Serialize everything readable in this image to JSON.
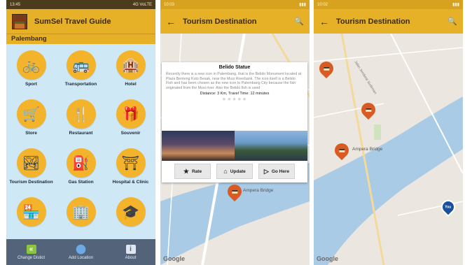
{
  "screen1": {
    "status": {
      "time": "13:45",
      "network": "4G VoLTE"
    },
    "app_title": "SumSel Travel Guide",
    "location": "Palembang",
    "categories": [
      {
        "label": "Sport",
        "icon": "bicycle-icon",
        "glyph": "🚲"
      },
      {
        "label": "Transportation",
        "icon": "bus-icon",
        "glyph": "🚌"
      },
      {
        "label": "Hotel",
        "icon": "hotel-icon",
        "glyph": "🏨"
      },
      {
        "label": "Store",
        "icon": "shopping-cart-icon",
        "glyph": "🛒"
      },
      {
        "label": "Restaurant",
        "icon": "cutlery-icon",
        "glyph": "🍴"
      },
      {
        "label": "Souvenir",
        "icon": "gift-icon",
        "glyph": "🎁"
      },
      {
        "label": "Tourism Destination",
        "icon": "landscape-icon",
        "glyph": "🏞"
      },
      {
        "label": "Gas Station",
        "icon": "fuel-pump-icon",
        "glyph": "⛽"
      },
      {
        "label": "Hospital & Clinic",
        "icon": "torii-gate-icon",
        "glyph": "⛩"
      },
      {
        "label": "",
        "icon": "shop-front-icon",
        "glyph": "🏪"
      },
      {
        "label": "",
        "icon": "office-building-icon",
        "glyph": "🏢"
      },
      {
        "label": "",
        "icon": "graduation-cap-icon",
        "glyph": "🎓"
      }
    ],
    "bottom_nav": [
      {
        "label": "Change Distict",
        "icon": "double-chevron-left-icon",
        "glyph": "«"
      },
      {
        "label": "Add Location",
        "icon": "map-pin-icon",
        "glyph": "⬤"
      },
      {
        "label": "About",
        "icon": "info-icon",
        "glyph": "i"
      }
    ]
  },
  "screen2": {
    "status": {
      "time": "10:03"
    },
    "title": "Tourism Destination",
    "popup": {
      "title": "Belido Statue",
      "description": "Recently there is a new icon in Palembang, that is the Belido Monument located at Plaza Benteng Kuto Besak, near the Musi Riverbank. The icon itself is a Belido Fish and has been chosen as the new icon to Palembang City because the fish originated from the Musi river. Also the Belido fish is used",
      "distance": "Distance: 3 Km, Travel Time: 12 minutes",
      "rating": 0,
      "actions": [
        {
          "label": "Rate",
          "icon": "star-rate-icon",
          "glyph": "★"
        },
        {
          "label": "Update",
          "icon": "update-icon",
          "glyph": "⌂"
        },
        {
          "label": "Go Here",
          "icon": "play-icon",
          "glyph": "▷"
        }
      ]
    },
    "bridge_label": "Ampera Bridge",
    "map_brand": "Google"
  },
  "screen3": {
    "status": {
      "time": "10:02"
    },
    "title": "Tourism Destination",
    "bridge_label": "Ampera Bridge",
    "street_label": "Jalan Jenderal Sudirman",
    "you_label": "You",
    "map_brand": "Google"
  },
  "colors": {
    "accent": "#e7b127",
    "pin": "#d95a23",
    "you_pin": "#1a4f9c",
    "river": "#aacbe6",
    "nav": "#53637a"
  }
}
